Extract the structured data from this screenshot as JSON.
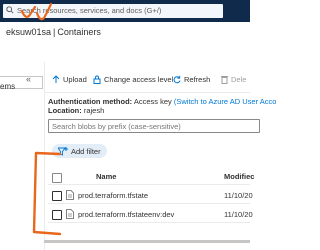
{
  "header": {
    "search_placeholder": "Search resources, services, and docs (G+/)"
  },
  "breadcrumb": {
    "account": "eksuw01sa",
    "separator": "|",
    "section": "Containers"
  },
  "sidebar": {
    "collapse_glyph": "«",
    "selected_item_fragment": "ems"
  },
  "toolbar": {
    "upload_label": "Upload",
    "change_access_label": "Change access level",
    "refresh_label": "Refresh",
    "delete_label": "Dele"
  },
  "auth": {
    "method_label": "Authentication method:",
    "method_value": "Access key",
    "switch_link": "(Switch to Azure AD User Acco",
    "location_label": "Location:",
    "location_value": "rajesh"
  },
  "blob_search": {
    "placeholder": "Search blobs by prefix (case-sensitive)"
  },
  "filter": {
    "add_label": "Add filter"
  },
  "table": {
    "columns": [
      "Name",
      "Modifiec"
    ],
    "rows": [
      {
        "name": "prod.terraform.tfstate",
        "modified": "11/10/20"
      },
      {
        "name": "prod.terraform.tfstateenv:dev",
        "modified": "11/10/20"
      }
    ]
  },
  "colors": {
    "topbar": "#0f2a4a",
    "accent": "#0078d4",
    "annotation": "#e8671c"
  }
}
